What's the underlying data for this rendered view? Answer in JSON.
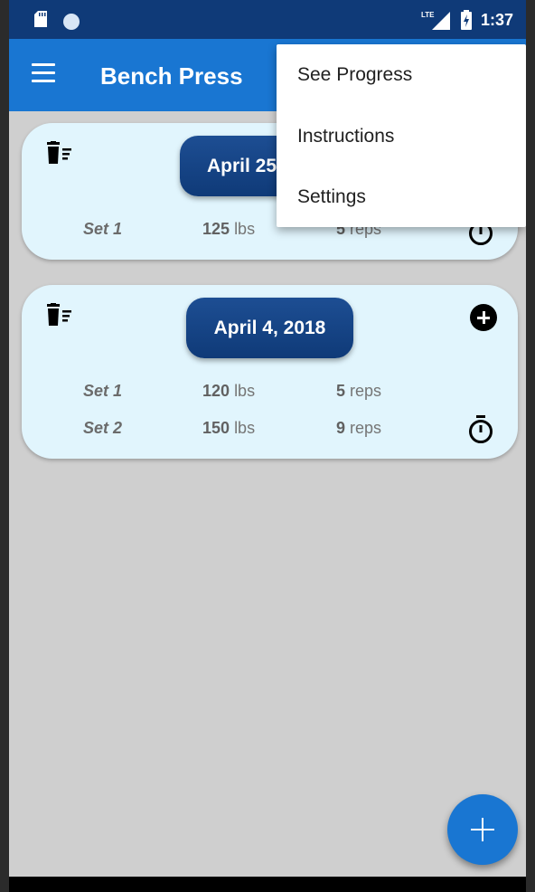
{
  "status_bar": {
    "network": "LTE",
    "time": "1:37"
  },
  "app_bar": {
    "title": "Bench Press"
  },
  "menu": {
    "items": [
      "See Progress",
      "Instructions",
      "Settings"
    ]
  },
  "cards": [
    {
      "date": "April 25",
      "sets": [
        {
          "label": "Set 1",
          "weight": "125",
          "weight_unit": "lbs",
          "reps": "5",
          "reps_unit": "reps"
        }
      ]
    },
    {
      "date": "April 4, 2018",
      "sets": [
        {
          "label": "Set 1",
          "weight": "120",
          "weight_unit": "lbs",
          "reps": "5",
          "reps_unit": "reps"
        },
        {
          "label": "Set 2",
          "weight": "150",
          "weight_unit": "lbs",
          "reps": "9",
          "reps_unit": "reps"
        }
      ]
    }
  ],
  "colors": {
    "status_bar": "#0f3a78",
    "app_bar": "#1976d2",
    "card": "#e1f5fd",
    "date_pill": "#1d4e93",
    "fab": "#1976d2",
    "background": "#cfcfcf"
  },
  "icons": [
    "sd-card-icon",
    "circle-indicator-icon",
    "lte-signal-icon",
    "battery-charging-icon",
    "menu-icon",
    "trash-list-icon",
    "add-circle-icon",
    "stopwatch-icon",
    "add-icon"
  ]
}
